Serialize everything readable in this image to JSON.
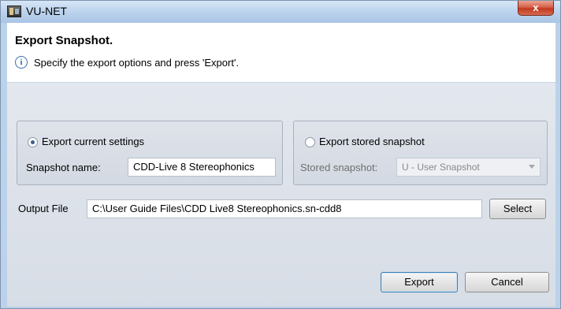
{
  "window": {
    "title": "VU-NET",
    "close_label": "x"
  },
  "header": {
    "title": "Export Snapshot.",
    "info_icon": "i",
    "info_text": "Specify the export options and press 'Export'."
  },
  "current_group": {
    "radio_label": "Export current settings",
    "selected": true,
    "name_label": "Snapshot name:",
    "name_value": "CDD-Live 8 Stereophonics"
  },
  "stored_group": {
    "radio_label": "Export stored snapshot",
    "selected": false,
    "stored_label": "Stored snapshot:",
    "stored_value": "U - User Snapshot"
  },
  "output": {
    "label": "Output File",
    "value": "C:\\User Guide Files\\CDD Live8 Stereophonics.sn-cdd8",
    "select_label": "Select"
  },
  "buttons": {
    "export_label": "Export",
    "cancel_label": "Cancel"
  }
}
